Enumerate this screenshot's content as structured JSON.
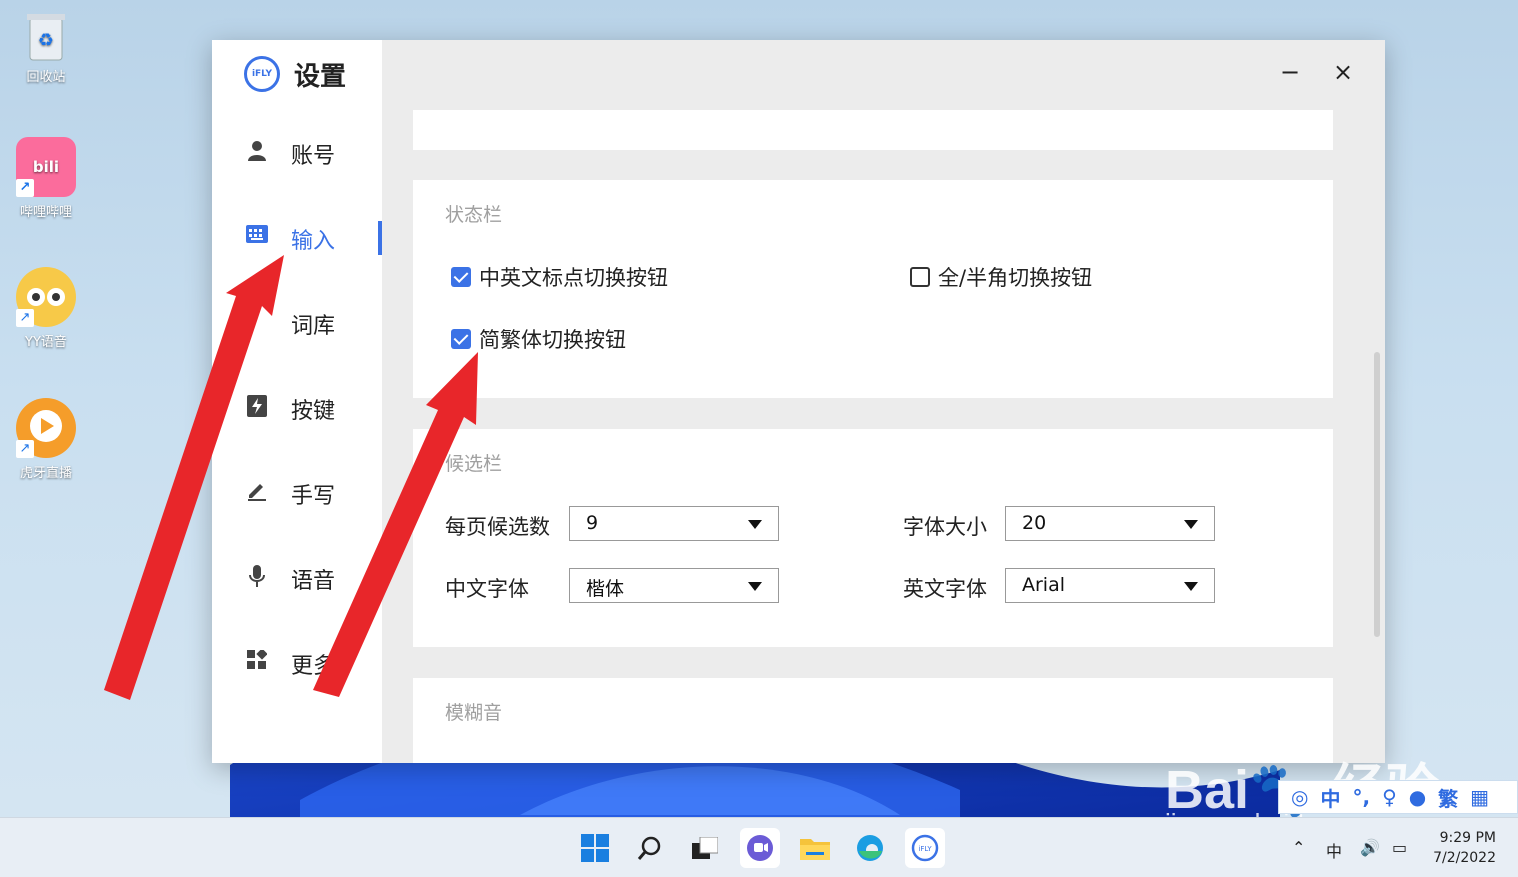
{
  "desktop": {
    "icons": [
      {
        "label": "回收站",
        "icon": "recycle-bin-icon"
      },
      {
        "label": "哔哩哔哩",
        "icon": "bilibili-icon"
      },
      {
        "label": "YY语音",
        "icon": "yy-icon"
      },
      {
        "label": "虎牙直播",
        "icon": "huya-icon"
      }
    ]
  },
  "window": {
    "logo": "iFLY",
    "title": "设置",
    "minimize": "−",
    "close": "×"
  },
  "sidebar": {
    "items": [
      {
        "label": "账号",
        "icon": "user-icon"
      },
      {
        "label": "输入",
        "icon": "keyboard-icon",
        "active": true
      },
      {
        "label": "词库",
        "icon": "library-icon"
      },
      {
        "label": "按键",
        "icon": "lightning-icon"
      },
      {
        "label": "手写",
        "icon": "pen-icon"
      },
      {
        "label": "语音",
        "icon": "microphone-icon"
      },
      {
        "label": "更多",
        "icon": "grid-icon"
      }
    ]
  },
  "statusbar": {
    "title": "状态栏",
    "options": [
      {
        "label": "中英文标点切换按钮",
        "checked": true
      },
      {
        "label": "全/半角切换按钮",
        "checked": false
      },
      {
        "label": "简繁体切换按钮",
        "checked": true
      }
    ]
  },
  "candidate": {
    "title": "候选栏",
    "per_page_label": "每页候选数",
    "per_page_value": "9",
    "font_size_label": "字体大小",
    "font_size_value": "20",
    "cn_font_label": "中文字体",
    "cn_font_value": "楷体",
    "en_font_label": "英文字体",
    "en_font_value": "Arial"
  },
  "fuzzy": {
    "title": "模糊音"
  },
  "ime": {
    "mode": "中",
    "punct": "°,",
    "trad": "繁"
  },
  "watermark": {
    "brand": "Bai",
    "suffix": "经验",
    "url": "jingyan.baidu.com"
  },
  "clock": {
    "time": "9:29 PM",
    "date": "7/2/2022"
  },
  "colors": {
    "accent": "#3b72e6",
    "arrow": "#e8262a"
  }
}
